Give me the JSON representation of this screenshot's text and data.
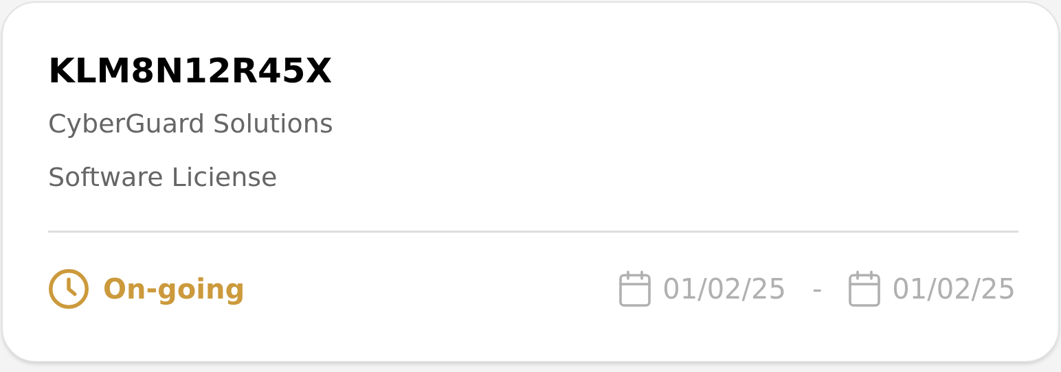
{
  "card": {
    "title": "KLM8N12R45X",
    "company": "CyberGuard Solutions",
    "category": "Software Liciense",
    "status": {
      "kind": "ongoing",
      "label": "On-going"
    },
    "start_date": "01/02/25",
    "separator": "-",
    "end_date": "01/02/25"
  }
}
